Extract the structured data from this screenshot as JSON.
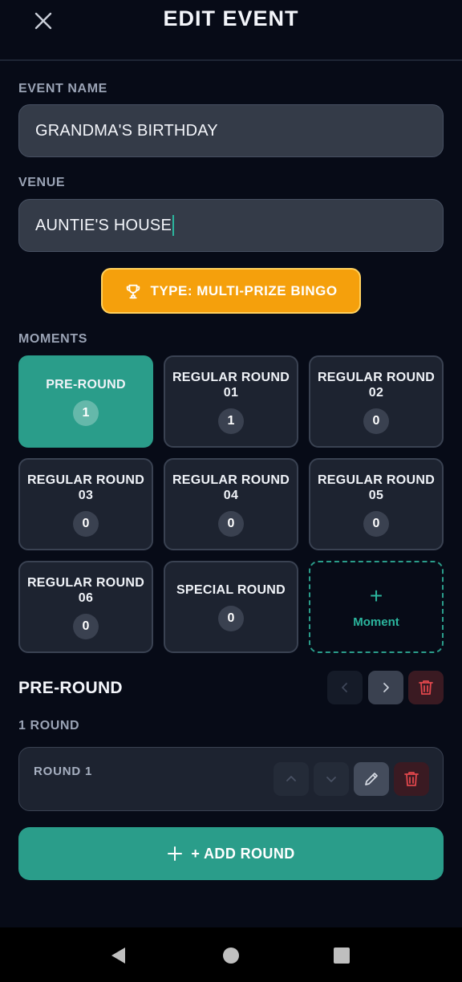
{
  "header": {
    "title": "EDIT EVENT",
    "close_icon": "close-icon"
  },
  "form": {
    "event_name_label": "EVENT NAME",
    "event_name_value": "GRANDMA'S BIRTHDAY",
    "venue_label": "VENUE",
    "venue_value": "AUNTIE'S HOUSE",
    "type_button_label": "TYPE: MULTI-PRIZE BINGO",
    "type_icon": "trophy-icon"
  },
  "moments": {
    "label": "MOMENTS",
    "items": [
      {
        "name": "PRE-ROUND",
        "count": "1",
        "active": true
      },
      {
        "name": "REGULAR ROUND 01",
        "count": "1",
        "active": false
      },
      {
        "name": "REGULAR ROUND 02",
        "count": "0",
        "active": false
      },
      {
        "name": "REGULAR ROUND 03",
        "count": "0",
        "active": false
      },
      {
        "name": "REGULAR ROUND 04",
        "count": "0",
        "active": false
      },
      {
        "name": "REGULAR ROUND 05",
        "count": "0",
        "active": false
      },
      {
        "name": "REGULAR ROUND 06",
        "count": "0",
        "active": false
      },
      {
        "name": "SPECIAL ROUND",
        "count": "0",
        "active": false
      }
    ],
    "add_label": "Moment"
  },
  "selected_moment": {
    "title": "PRE-ROUND",
    "rounds_count_label": "1 ROUND",
    "rounds": [
      {
        "name": "ROUND 1"
      }
    ],
    "add_round_label": "+ ADD ROUND"
  },
  "colors": {
    "background": "#070b17",
    "accent_teal": "#2a9d8a",
    "type_orange": "#f5a00c",
    "danger_red": "#e0474c",
    "card": "#1d2330"
  },
  "navbar": {
    "icons": [
      "back-icon",
      "home-icon",
      "recents-icon"
    ]
  }
}
